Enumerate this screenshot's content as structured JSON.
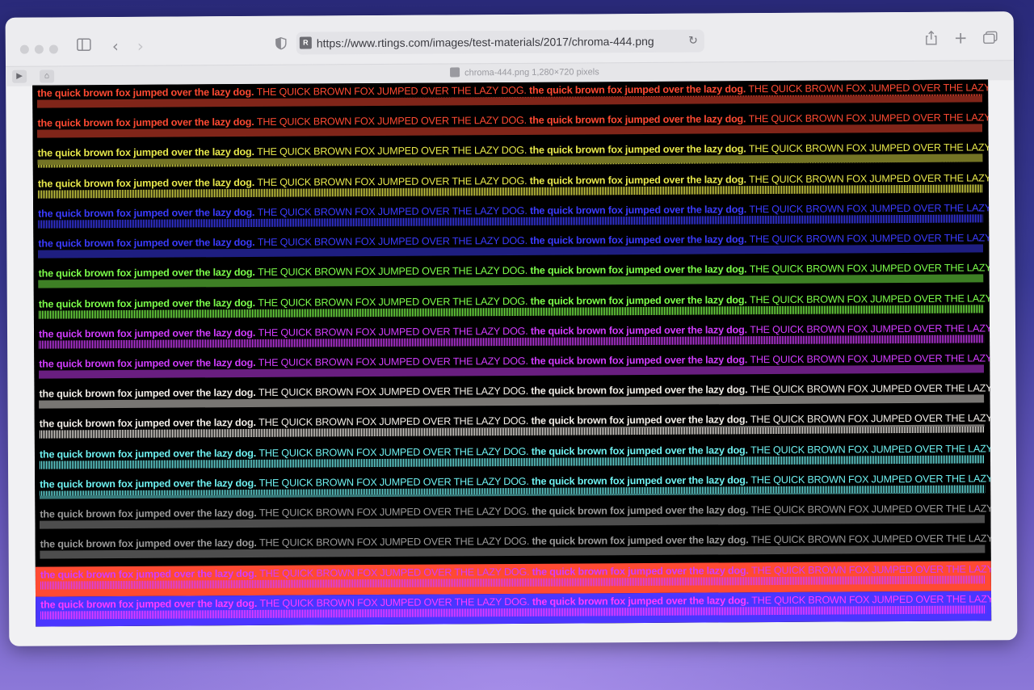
{
  "browser": {
    "url": "https://www.rtings.com/images/test-materials/2017/chroma-444.png",
    "site_logo_text": "R",
    "image_title": "chroma-444.png 1,280×720 pixels",
    "tab_buttons": [
      "▶",
      "⌂"
    ]
  },
  "icons": {
    "sidebar": "sidebar-icon",
    "back": "chevron-left-icon",
    "forward": "chevron-right-icon",
    "shield": "privacy-shield-icon",
    "reload": "reload-icon",
    "share": "share-icon",
    "new_tab": "plus-icon",
    "tabs": "tab-overview-icon"
  },
  "test_image": {
    "lowercase_text": "the quick brown fox jumped over the lazy dog.",
    "uppercase_text": "THE QUICK BROWN FOX JUMPED OVER THE LAZY DOG.",
    "rows": [
      {
        "fg": "#ff4a32",
        "bg": "#000000"
      },
      {
        "fg": "#ff4a32",
        "bg": "#000000"
      },
      {
        "fg": "#e8e84a",
        "bg": "#000000"
      },
      {
        "fg": "#e8e84a",
        "bg": "#000000"
      },
      {
        "fg": "#3b3bff",
        "bg": "#000000"
      },
      {
        "fg": "#3b3bff",
        "bg": "#000000"
      },
      {
        "fg": "#7cff4a",
        "bg": "#000000"
      },
      {
        "fg": "#7cff4a",
        "bg": "#000000"
      },
      {
        "fg": "#d23cff",
        "bg": "#000000"
      },
      {
        "fg": "#d23cff",
        "bg": "#000000"
      },
      {
        "fg": "#f0ece6",
        "bg": "#000000"
      },
      {
        "fg": "#f0ece6",
        "bg": "#000000"
      },
      {
        "fg": "#6ef0f0",
        "bg": "#000000"
      },
      {
        "fg": "#6ef0f0",
        "bg": "#000000"
      },
      {
        "fg": "#9a9a9a",
        "bg": "#000000"
      },
      {
        "fg": "#9a9a9a",
        "bg": "#000000"
      },
      {
        "fg": "#d23cff",
        "bg": "#ff4a32"
      },
      {
        "fg": "#ff3cff",
        "bg": "#4a36ff"
      }
    ]
  }
}
